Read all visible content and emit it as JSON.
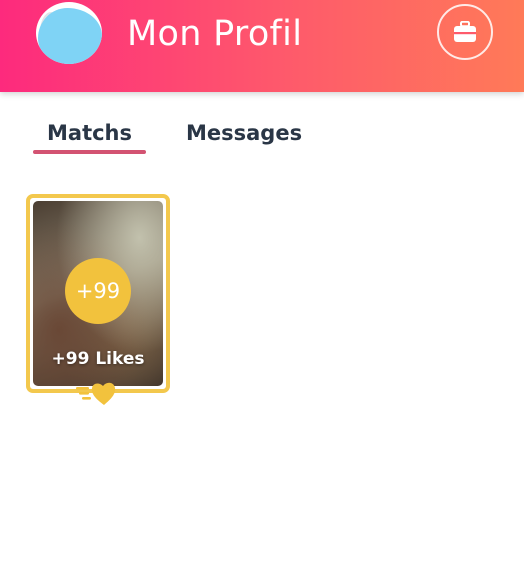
{
  "header": {
    "title": "Mon Profil",
    "gradient_colors": [
      "#fd2a7d",
      "#ff7a58"
    ]
  },
  "header_icons": {
    "avatar": "avatar",
    "right_button_icon": "briefcase-icon"
  },
  "tabs": {
    "items": [
      {
        "label": "Matchs",
        "active": true
      },
      {
        "label": "Messages",
        "active": false
      }
    ],
    "underline_color": "#d35372"
  },
  "likes_card": {
    "badge": "+99",
    "label": "+99 Likes",
    "frame_color": "#f3c84d",
    "badge_color": "#f2c23d",
    "icon": "golden-heart-icon"
  }
}
